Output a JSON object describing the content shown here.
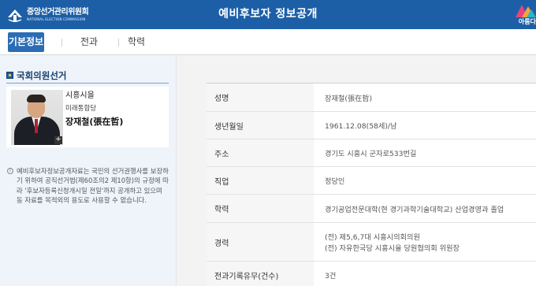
{
  "header": {
    "org_name": "중앙선거관리위원회",
    "org_name_en": "NATIONAL ELECTION COMMISSION",
    "title": "예비후보자 정보공개",
    "corner_text": "아름다",
    "brand_color": "#1c5fa7"
  },
  "tabs": [
    {
      "label": "기본정보",
      "active": true
    },
    {
      "label": "전과",
      "active": false
    },
    {
      "label": "학력",
      "active": false
    }
  ],
  "sidebar": {
    "section_title": "국회의원선거",
    "candidate": {
      "region": "시흥시을",
      "party": "미래통합당",
      "name": "장재철(張在哲)",
      "photo_alt": "candidate-photo"
    },
    "notice": "예비후보자정보공개자료는 국민의 선거권행사를 보장하기 위하여 공직선거법(제60조의2 제10항)의 규정에 따라 '후보자등록신청개시일 전일'까지 공개하고 있으며 동 자료를 목적외의 용도로 사용할 수 없습니다."
  },
  "info": {
    "rows": [
      {
        "label": "성명",
        "values": [
          "장재철(張在哲)"
        ]
      },
      {
        "label": "생년월일",
        "values": [
          "1961.12.08(58세)/남"
        ]
      },
      {
        "label": "주소",
        "values": [
          "경기도 시흥시 군자로533번길"
        ]
      },
      {
        "label": "직업",
        "values": [
          "정당인"
        ]
      },
      {
        "label": "학력",
        "values": [
          "경기공업전문대학(현 경기과학기술대학교) 산업경영과 졸업"
        ]
      },
      {
        "label": "경력",
        "values": [
          "(전) 제5,6,7대 시흥시의회의원",
          "(전) 자유한국당 시흥시을 당원협의회 위원장"
        ]
      },
      {
        "label": "전과기록유무(건수)",
        "values": [
          "3건"
        ]
      }
    ]
  }
}
